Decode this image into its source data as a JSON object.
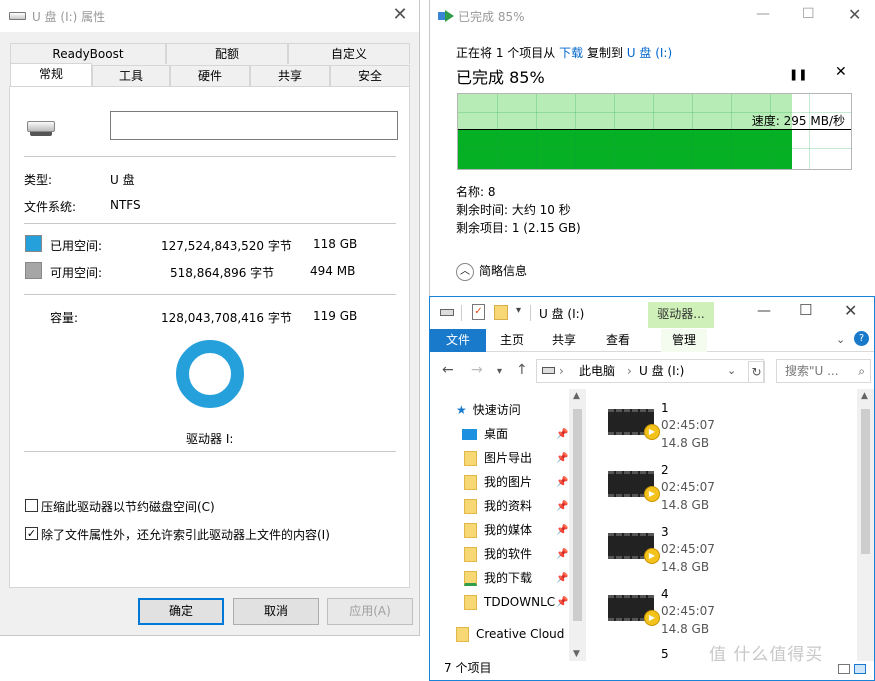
{
  "props": {
    "title": "U 盘 (I:) 属性",
    "tabs_row1": [
      "ReadyBoost",
      "配额",
      "自定义"
    ],
    "tabs_row2": [
      "常规",
      "工具",
      "硬件",
      "共享",
      "安全"
    ],
    "type_label": "类型:",
    "type_value": "U 盘",
    "fs_label": "文件系统:",
    "fs_value": "NTFS",
    "used_label": "已用空间:",
    "used_bytes": "127,524,843,520 字节",
    "used_size": "118 GB",
    "free_label": "可用空间:",
    "free_bytes": "518,864,896 字节",
    "free_size": "494 MB",
    "cap_label": "容量:",
    "cap_bytes": "128,043,708,416 字节",
    "cap_size": "119 GB",
    "drive_label": "驱动器 I:",
    "compress_label": "压缩此驱动器以节约磁盘空间(C)",
    "index_label": "除了文件属性外，还允许索引此驱动器上文件的内容(I)",
    "ok": "确定",
    "cancel": "取消",
    "apply": "应用(A)",
    "colors": {
      "used": "#26a0da",
      "free": "#a6a6a6"
    }
  },
  "copy": {
    "title": "已完成 85%",
    "line_prefix": "正在将 1 个项目从",
    "source": "下载",
    "line_mid": "复制到",
    "dest": "U 盘 (I:)",
    "big": "已完成 85%",
    "progress": 0.85,
    "speed": "速度: 295 MB/秒",
    "name_line": "名称: 8",
    "remaining_time": "剩余时间: 大约 10 秒",
    "remaining_items": "剩余项目: 1 (2.15 GB)",
    "details": "简略信息"
  },
  "explorer": {
    "title": "U 盘 (I:)",
    "tool_tab": "驱动器...",
    "ribbon": [
      "文件",
      "主页",
      "共享",
      "查看",
      "管理"
    ],
    "path": [
      "此电脑",
      "U 盘 (I:)"
    ],
    "search_placeholder": "搜索\"U ...",
    "nav": [
      "快速访问",
      "桌面",
      "图片导出",
      "我的图片",
      "我的资料",
      "我的媒体",
      "我的软件",
      "我的下载",
      "TDDOWNLC",
      "Creative Cloud F"
    ],
    "files": [
      {
        "name": "1",
        "time": "02:45:07",
        "size": "14.8 GB"
      },
      {
        "name": "2",
        "time": "02:45:07",
        "size": "14.8 GB"
      },
      {
        "name": "3",
        "time": "02:45:07",
        "size": "14.8 GB"
      },
      {
        "name": "4",
        "time": "02:45:07",
        "size": "14.8 GB"
      },
      {
        "name": "5"
      }
    ],
    "status": "7 个项目"
  },
  "watermark": "值 什么值得买"
}
